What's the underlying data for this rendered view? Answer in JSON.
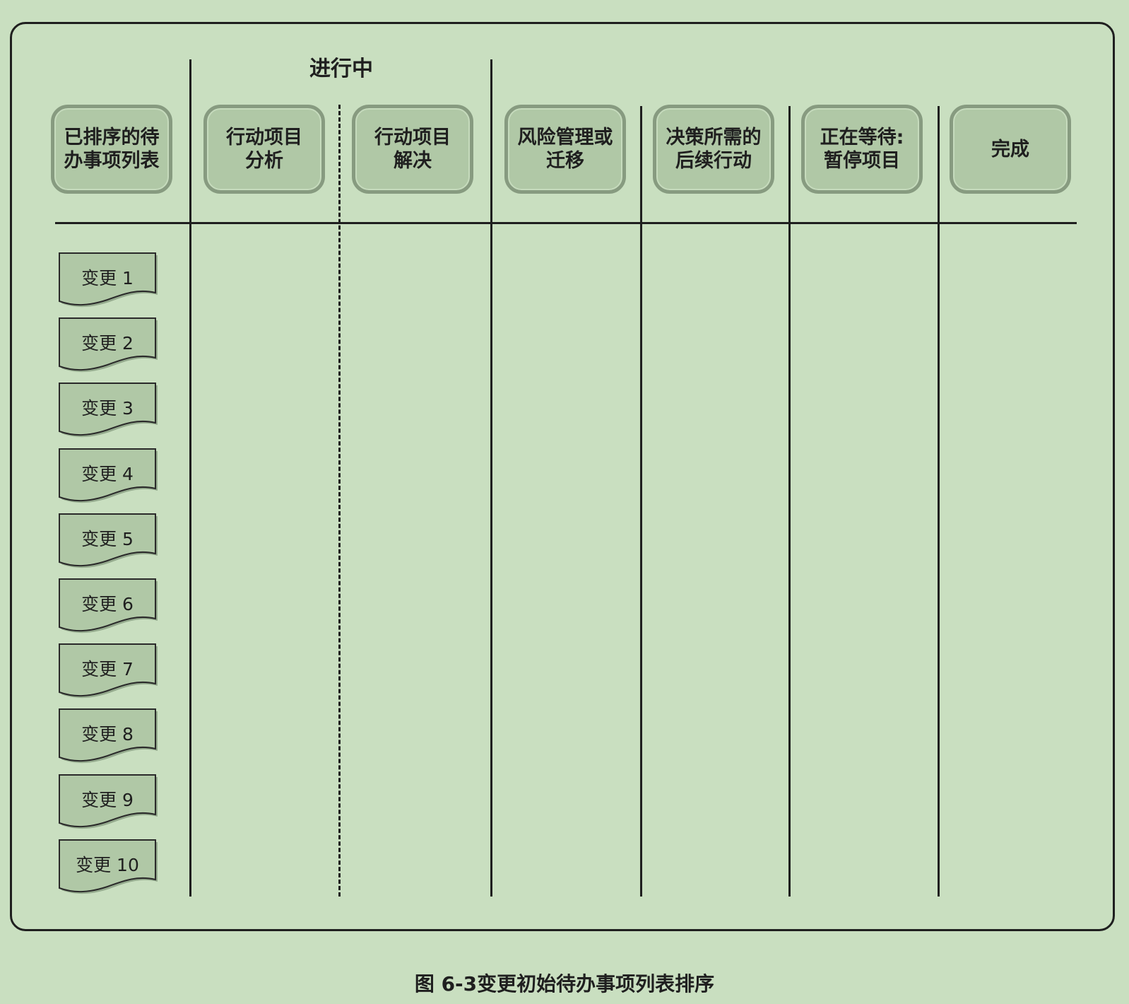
{
  "board": {
    "in_progress_label": "进行中",
    "columns": [
      {
        "label": "已排序的待\n办事项列表"
      },
      {
        "label": "行动项目\n分析"
      },
      {
        "label": "行动项目\n解决"
      },
      {
        "label": "风险管理或\n迁移"
      },
      {
        "label": "决策所需的\n后续行动"
      },
      {
        "label": "正在等待:\n暂停项目"
      },
      {
        "label": "完成"
      }
    ],
    "cards": [
      {
        "label": "变更 1"
      },
      {
        "label": "变更 2"
      },
      {
        "label": "变更 3"
      },
      {
        "label": "变更 4"
      },
      {
        "label": "变更 5"
      },
      {
        "label": "变更 6"
      },
      {
        "label": "变更 7"
      },
      {
        "label": "变更 8"
      },
      {
        "label": "变更 9"
      },
      {
        "label": "变更 10"
      }
    ]
  },
  "caption": "图 6-3变更初始待办事项列表排序",
  "colors": {
    "background": "#c9dfc0",
    "card_fill": "#b0c8a6",
    "card_border": "#879b80",
    "line": "#1f1f1f"
  }
}
